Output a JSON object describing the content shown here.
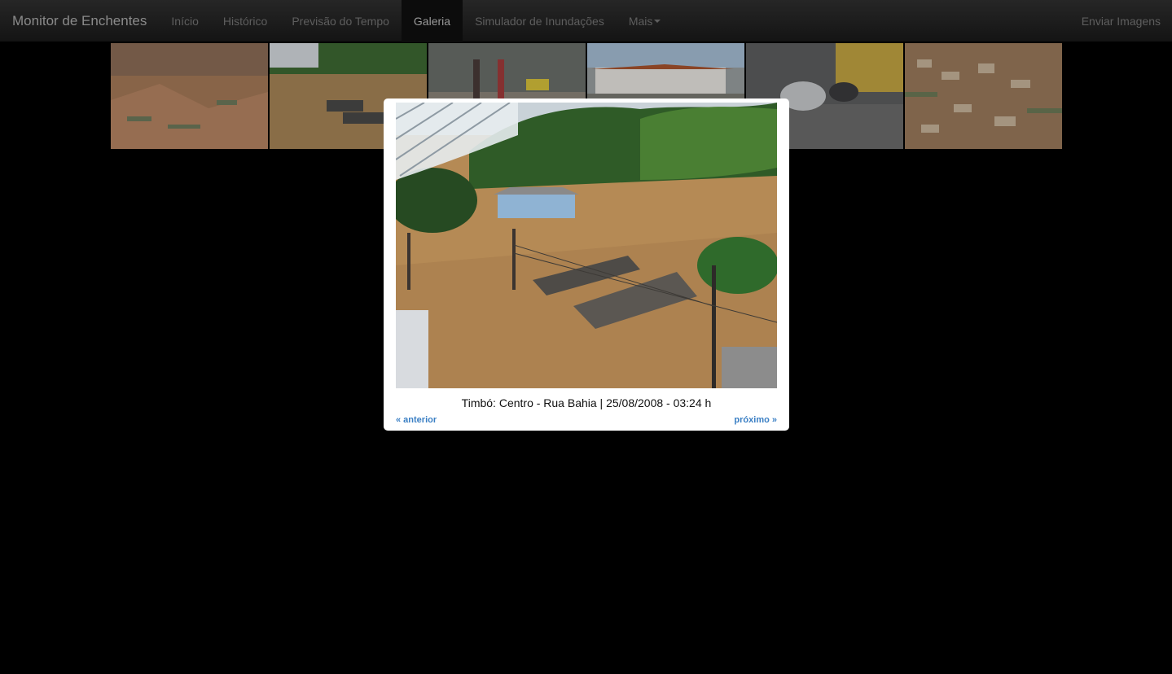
{
  "nav": {
    "brand": "Monitor de Enchentes",
    "items": [
      {
        "label": "Início"
      },
      {
        "label": "Histórico"
      },
      {
        "label": "Previsão do Tempo"
      },
      {
        "label": "Galeria"
      },
      {
        "label": "Simulador de Inundações"
      },
      {
        "label": "Mais"
      }
    ],
    "active_item": "Galeria",
    "right_link": "Enviar Imagens"
  },
  "gallery": {
    "thumbnails_count": 6
  },
  "lightbox": {
    "caption": "Timbó: Centro - Rua Bahia | 25/08/2008 - 03:24 h",
    "prev_label": "« anterior",
    "next_label": "próximo »"
  },
  "colors": {
    "link": "#3a7fc4",
    "navbar": "#1e1e1e",
    "flood_water": "#b58a55"
  }
}
